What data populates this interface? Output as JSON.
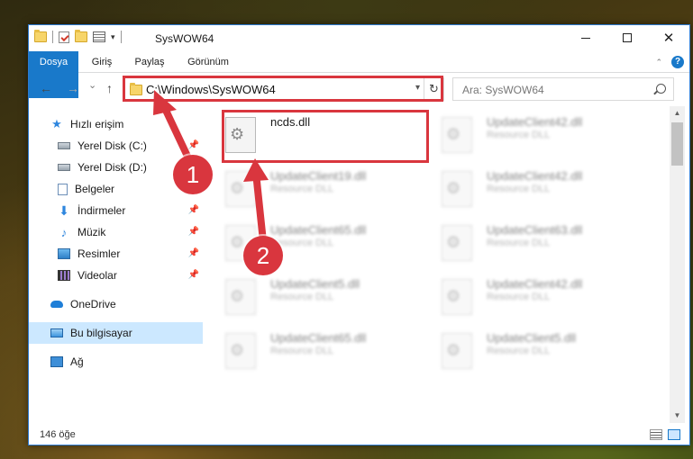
{
  "window": {
    "title": "SysWOW64"
  },
  "ribbon": {
    "tabs": [
      "Dosya",
      "Giriş",
      "Paylaş",
      "Görünüm"
    ],
    "help": "?"
  },
  "nav": {
    "back": "←",
    "forward": "→",
    "recent": "⌄",
    "up": "↑",
    "address": "C:\\Windows\\SysWOW64",
    "refresh": "↻",
    "search_placeholder": "Ara: SysWOW64"
  },
  "sidebar": {
    "items": [
      {
        "label": "Hızlı erişim",
        "icon": "star-icon",
        "pinned": false
      },
      {
        "label": "Yerel Disk (C:)",
        "icon": "disk-icon",
        "pinned": true
      },
      {
        "label": "Yerel Disk (D:)",
        "icon": "disk-icon",
        "pinned": false
      },
      {
        "label": "Belgeler",
        "icon": "documents-icon",
        "pinned": true
      },
      {
        "label": "İndirmeler",
        "icon": "download-icon",
        "pinned": true
      },
      {
        "label": "Müzik",
        "icon": "music-icon",
        "pinned": true
      },
      {
        "label": "Resimler",
        "icon": "pictures-icon",
        "pinned": true
      },
      {
        "label": "Videolar",
        "icon": "videos-icon",
        "pinned": true
      },
      {
        "label": "OneDrive",
        "icon": "onedrive-icon",
        "pinned": false
      },
      {
        "label": "Bu bilgisayar",
        "icon": "this-pc-icon",
        "pinned": false,
        "selected": true
      },
      {
        "label": "Ağ",
        "icon": "network-icon",
        "pinned": false
      }
    ]
  },
  "files": [
    {
      "name": "ncds.dll",
      "type": ""
    },
    {
      "name": "UpdateClient42.dll",
      "type": "Resource DLL"
    },
    {
      "name": "UpdateClient19.dll",
      "type": "Resource DLL"
    },
    {
      "name": "UpdateClient42.dll",
      "type": "Resource DLL"
    },
    {
      "name": "UpdateClient65.dll",
      "type": "Resource DLL"
    },
    {
      "name": "UpdateClient63.dll",
      "type": "Resource DLL"
    },
    {
      "name": "UpdateClient5.dll",
      "type": "Resource DLL"
    },
    {
      "name": "UpdateClient42.dll",
      "type": "Resource DLL"
    },
    {
      "name": "UpdateClient65.dll",
      "type": "Resource DLL"
    },
    {
      "name": "UpdateClient5.dll",
      "type": "Resource DLL"
    }
  ],
  "status": {
    "count": "146 öğe"
  },
  "annotations": {
    "badge1": "1",
    "badge2": "2"
  },
  "colors": {
    "accent": "#1979ca",
    "highlight": "#d9363e",
    "selected": "#cce8ff"
  }
}
